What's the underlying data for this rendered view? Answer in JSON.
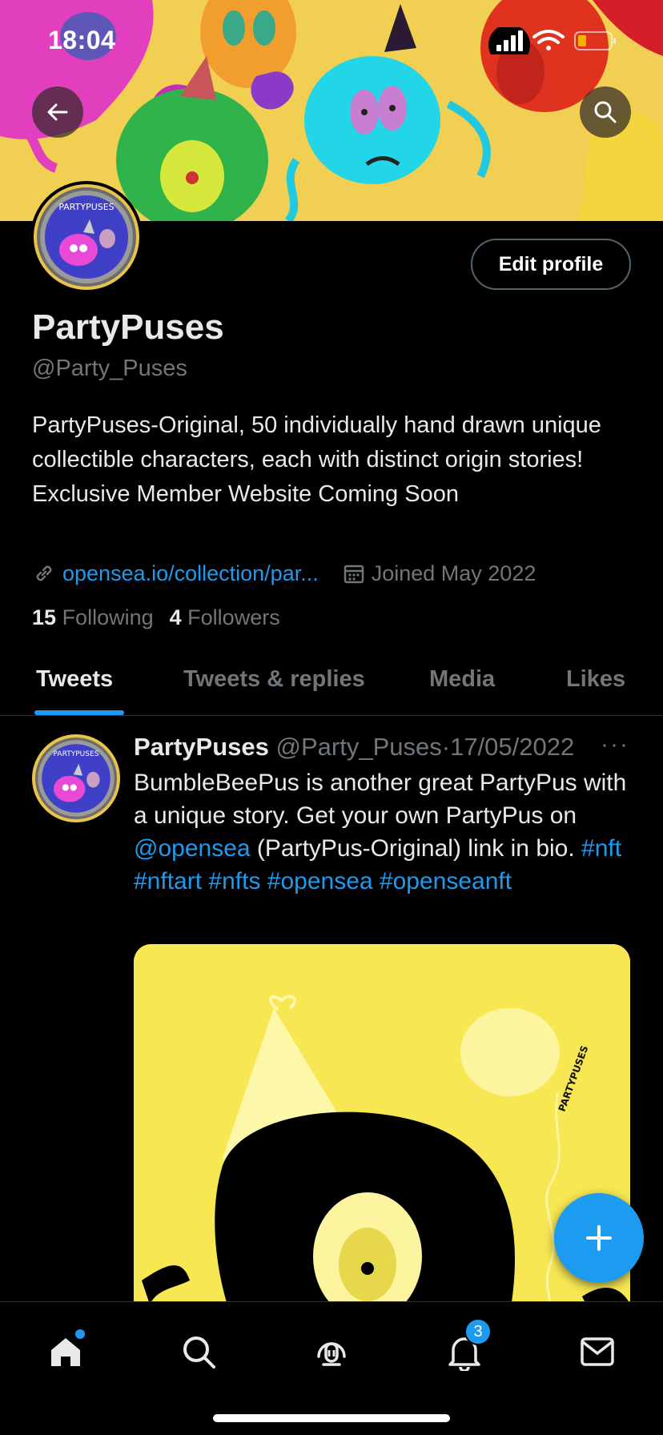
{
  "status": {
    "time": "18:04"
  },
  "profile": {
    "display_name": "PartyPuses",
    "handle": "@Party_Puses",
    "bio": "PartyPuses-Original, 50 individually hand drawn unique collectible characters, each with distinct origin stories! Exclusive Member Website Coming Soon",
    "link": "opensea.io/collection/par...",
    "joined": "Joined May 2022",
    "following_count": "15",
    "following_label": "Following",
    "followers_count": "4",
    "followers_label": "Followers",
    "avatar_text": "PARTYPUSES"
  },
  "buttons": {
    "edit_profile": "Edit profile"
  },
  "tabs": [
    {
      "label": "Tweets",
      "active": true
    },
    {
      "label": "Tweets & replies",
      "active": false
    },
    {
      "label": "Media",
      "active": false
    },
    {
      "label": "Likes",
      "active": false
    }
  ],
  "tweet": {
    "author": "PartyPuses",
    "handle": "@Party_Puses",
    "separator": "·",
    "date": "17/05/2022",
    "more": "···",
    "text_1": "BumbleBeePus is another great PartyPus with a unique story. Get your own PartyPus on ",
    "mention": "@opensea",
    "text_2": " (PartyPus-Original) link in bio. ",
    "hashtags": [
      "#nft",
      "#nftart",
      "#nfts",
      "#opensea",
      "#openseanft"
    ],
    "media_balloon_text": "PARTYPUSES"
  },
  "nav": {
    "notifications_badge": "3"
  },
  "colors": {
    "accent": "#1d9bf0",
    "background": "#000000",
    "muted": "#71767b",
    "media_bg": "#f7e752"
  },
  "icons": [
    "back-arrow-icon",
    "search-icon",
    "link-icon",
    "calendar-icon",
    "more-icon",
    "plus-icon",
    "home-icon",
    "search-nav-icon",
    "spaces-icon",
    "bell-icon",
    "mail-icon",
    "signal-icon",
    "wifi-icon",
    "battery-icon"
  ]
}
